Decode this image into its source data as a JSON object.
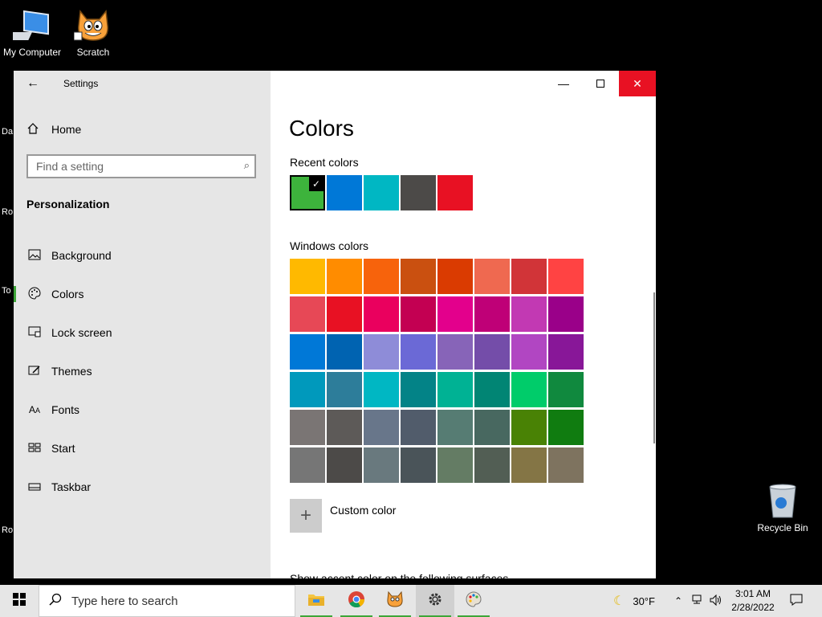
{
  "desktop": {
    "icons": [
      {
        "label": "My Computer"
      },
      {
        "label": "Scratch"
      },
      {
        "label": "Recycle Bin"
      }
    ],
    "edge_labels": [
      "Da",
      "Ro",
      "To",
      "Ro"
    ]
  },
  "window": {
    "title": "Settings",
    "home": "Home",
    "search_placeholder": "Find a setting",
    "section": "Personalization",
    "nav": [
      {
        "label": "Background",
        "icon": "image-icon"
      },
      {
        "label": "Colors",
        "icon": "palette-icon",
        "selected": true
      },
      {
        "label": "Lock screen",
        "icon": "lock-screen-icon"
      },
      {
        "label": "Themes",
        "icon": "brush-icon"
      },
      {
        "label": "Fonts",
        "icon": "font-icon"
      },
      {
        "label": "Start",
        "icon": "start-icon"
      },
      {
        "label": "Taskbar",
        "icon": "taskbar-icon"
      }
    ]
  },
  "colors_page": {
    "title": "Colors",
    "recent_label": "Recent colors",
    "recent_colors": [
      "#3db33c",
      "#0078d7",
      "#00b7c3",
      "#4c4a48",
      "#e81123"
    ],
    "windows_label": "Windows colors",
    "windows_colors": [
      "#ffb900",
      "#ff8c00",
      "#f7630c",
      "#ca5010",
      "#da3b01",
      "#ef6950",
      "#d13438",
      "#ff4343",
      "#e74856",
      "#e81123",
      "#ea005e",
      "#c30052",
      "#e3008c",
      "#bf0077",
      "#c239b3",
      "#9a0089",
      "#0078d7",
      "#0063b1",
      "#8e8cd8",
      "#6b69d6",
      "#8764b8",
      "#744da9",
      "#b146c2",
      "#881798",
      "#0099bc",
      "#2d7d9a",
      "#00b7c3",
      "#038387",
      "#00b294",
      "#018574",
      "#00cc6a",
      "#10893e",
      "#7a7574",
      "#5d5a58",
      "#68768a",
      "#515c6b",
      "#567c73",
      "#486860",
      "#498205",
      "#107c10",
      "#767676",
      "#4c4a48",
      "#69797e",
      "#4a5459",
      "#647c64",
      "#525e54",
      "#847545",
      "#7e735f"
    ],
    "custom_label": "Custom color",
    "cut_off_text": "Show accent color on the following surfaces"
  },
  "taskbar": {
    "search_placeholder": "Type here to search",
    "apps": [
      {
        "name": "file-explorer-icon",
        "running": true
      },
      {
        "name": "chrome-icon",
        "running": true
      },
      {
        "name": "scratch-icon",
        "running": true
      },
      {
        "name": "settings-icon",
        "running": true,
        "active": true
      },
      {
        "name": "paint-icon",
        "running": true
      }
    ],
    "weather": "30°F",
    "time": "3:01 AM",
    "date": "2/28/2022"
  }
}
